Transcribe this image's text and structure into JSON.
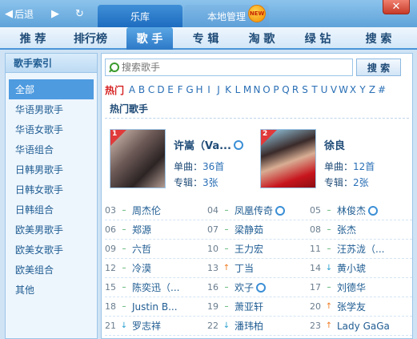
{
  "nav": {
    "back_label": "后退",
    "back_glyph": "◀",
    "forward_glyph": "▶",
    "refresh_glyph": "↻"
  },
  "top_tabs": [
    {
      "label": "乐库",
      "active": true
    },
    {
      "label": "本地管理",
      "active": false
    }
  ],
  "new_badge": "NEW",
  "close_glyph": "✕",
  "categories": [
    {
      "label": "推 荐"
    },
    {
      "label": "排行榜"
    },
    {
      "label": "歌 手",
      "active": true
    },
    {
      "label": "专 辑"
    },
    {
      "label": "淘 歌"
    },
    {
      "label": "绿 钻"
    },
    {
      "label": "搜 索"
    }
  ],
  "sidebar": {
    "title": "歌手索引",
    "items": [
      "全部",
      "华语男歌手",
      "华语女歌手",
      "华语组合",
      "日韩男歌手",
      "日韩女歌手",
      "日韩组合",
      "欧美男歌手",
      "欧美女歌手",
      "欧美组合",
      "其他"
    ]
  },
  "search": {
    "placeholder": "搜索歌手",
    "button_label": "搜 索"
  },
  "alphabet": {
    "hot": "热门",
    "letters": [
      "A",
      "B",
      "C",
      "D",
      "E",
      "F",
      "G",
      "H",
      "I",
      "J",
      "K",
      "L",
      "M",
      "N",
      "O",
      "P",
      "Q",
      "R",
      "S",
      "T",
      "U",
      "V",
      "W",
      "X",
      "Y",
      "Z",
      "#"
    ]
  },
  "section_title": "热门歌手",
  "featured": [
    {
      "rank": "1",
      "name": "许嵩（Va...",
      "songs_label": "单曲：",
      "songs": "36首",
      "albums_label": "专辑：",
      "albums": "3张"
    },
    {
      "rank": "2",
      "name": "徐良",
      "songs_label": "单曲：",
      "songs": "12首",
      "albums_label": "专辑：",
      "albums": "2张"
    }
  ],
  "singers": [
    [
      {
        "num": "03",
        "trend": "flat",
        "name": "周杰伦"
      },
      {
        "num": "04",
        "trend": "flat",
        "name": "凤凰传奇",
        "pod": true
      },
      {
        "num": "05",
        "trend": "flat",
        "name": "林俊杰",
        "pod": true
      }
    ],
    [
      {
        "num": "06",
        "trend": "flat",
        "name": "郑源"
      },
      {
        "num": "07",
        "trend": "flat",
        "name": "梁静茹"
      },
      {
        "num": "08",
        "trend": "flat",
        "name": "张杰"
      }
    ],
    [
      {
        "num": "09",
        "trend": "flat",
        "name": "六哲"
      },
      {
        "num": "10",
        "trend": "flat",
        "name": "王力宏"
      },
      {
        "num": "11",
        "trend": "flat",
        "name": "汪苏泷（..."
      }
    ],
    [
      {
        "num": "12",
        "trend": "flat",
        "name": "冷漠"
      },
      {
        "num": "13",
        "trend": "up",
        "name": "丁当"
      },
      {
        "num": "14",
        "trend": "down",
        "name": "黄小琥"
      }
    ],
    [
      {
        "num": "15",
        "trend": "flat",
        "name": "陈奕迅（..."
      },
      {
        "num": "16",
        "trend": "flat",
        "name": "欢子",
        "pod": true
      },
      {
        "num": "17",
        "trend": "flat",
        "name": "刘德华"
      }
    ],
    [
      {
        "num": "18",
        "trend": "flat",
        "name": "Justin B..."
      },
      {
        "num": "19",
        "trend": "flat",
        "name": "萧亚轩"
      },
      {
        "num": "20",
        "trend": "up",
        "name": "张学友"
      }
    ],
    [
      {
        "num": "21",
        "trend": "down",
        "name": "罗志祥"
      },
      {
        "num": "22",
        "trend": "down",
        "name": "潘玮柏"
      },
      {
        "num": "23",
        "trend": "up",
        "name": "Lady GaGa"
      }
    ]
  ]
}
